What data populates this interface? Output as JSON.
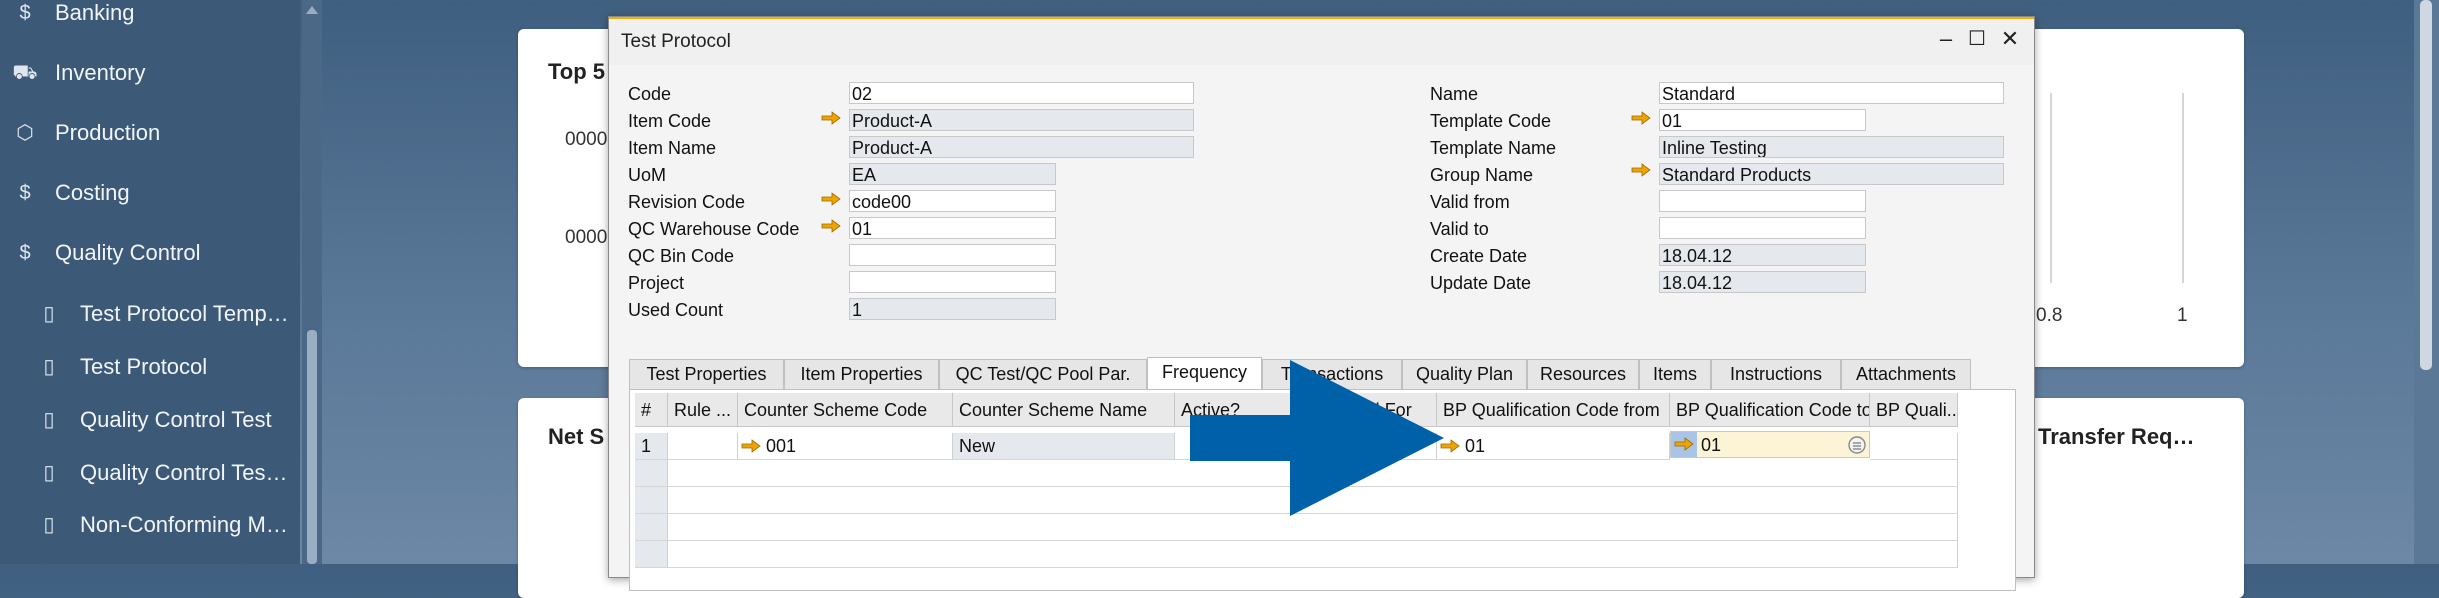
{
  "sidebar": {
    "items": [
      {
        "label": "Banking",
        "icon": "dollar-circle-icon"
      },
      {
        "label": "Inventory",
        "icon": "forklift-icon"
      },
      {
        "label": "Production",
        "icon": "gear-box-icon"
      },
      {
        "label": "Costing",
        "icon": "costing-icon"
      },
      {
        "label": "Quality Control",
        "icon": "quality-control-icon"
      }
    ],
    "subitems": [
      {
        "label": "Test Protocol Temp…"
      },
      {
        "label": "Test Protocol"
      },
      {
        "label": "Quality Control Test"
      },
      {
        "label": "Quality Control Tes…"
      },
      {
        "label": "Non-Conforming M…"
      }
    ]
  },
  "background": {
    "card_top_title": "Top 5",
    "card_top_y1": "0000",
    "card_top_y2": "0000",
    "card_top_x1": "0.8",
    "card_top_x2": "1",
    "card_bottom_title": "Net S",
    "card_bottom_title_right": "Transfer Req…"
  },
  "dialog": {
    "title": "Test Protocol",
    "left_fields": [
      {
        "label": "Code",
        "value": "02"
      },
      {
        "label": "Item Code",
        "value": "Product-A"
      },
      {
        "label": "Item Name",
        "value": "Product-A"
      },
      {
        "label": "UoM",
        "value": "EA"
      },
      {
        "label": "Revision Code",
        "value": "code00"
      },
      {
        "label": "QC Warehouse Code",
        "value": "01"
      },
      {
        "label": "QC Bin Code",
        "value": ""
      },
      {
        "label": "Project",
        "value": ""
      },
      {
        "label": "Used Count",
        "value": "1"
      }
    ],
    "right_fields": [
      {
        "label": "Name",
        "value": "Standard"
      },
      {
        "label": "Template Code",
        "value": "01"
      },
      {
        "label": "Template Name",
        "value": "Inline Testing"
      },
      {
        "label": "Group Name",
        "value": "Standard Products"
      },
      {
        "label": "Valid from",
        "value": ""
      },
      {
        "label": "Valid to",
        "value": ""
      },
      {
        "label": "Create Date",
        "value": "18.04.12"
      },
      {
        "label": "Update Date",
        "value": "18.04.12"
      }
    ],
    "tabs": [
      "Test Properties",
      "Item Properties",
      "QC Test/QC Pool Par.",
      "Frequency",
      "Transactions",
      "Quality Plan",
      "Resources",
      "Items",
      "Instructions",
      "Attachments"
    ],
    "active_tab": "Frequency",
    "grid": {
      "headers": [
        "#",
        "Rule ...",
        "Counter Scheme Code",
        "Counter Scheme Name",
        "Active?",
        "Valid For",
        "BP Qualification Code from",
        "BP Qualification Code to",
        "BP Quali..."
      ],
      "rows": [
        {
          "num": "1",
          "rule": "",
          "counter_code": "001",
          "counter_name": "New",
          "active": "",
          "valid_for": "",
          "bp_from": "01",
          "bp_to": "01",
          "bp_quali": ""
        }
      ]
    }
  },
  "colors": {
    "overlay_arrow": "#0060a8",
    "link_arrow": "#f0a400",
    "title_accent": "#f0b400"
  }
}
